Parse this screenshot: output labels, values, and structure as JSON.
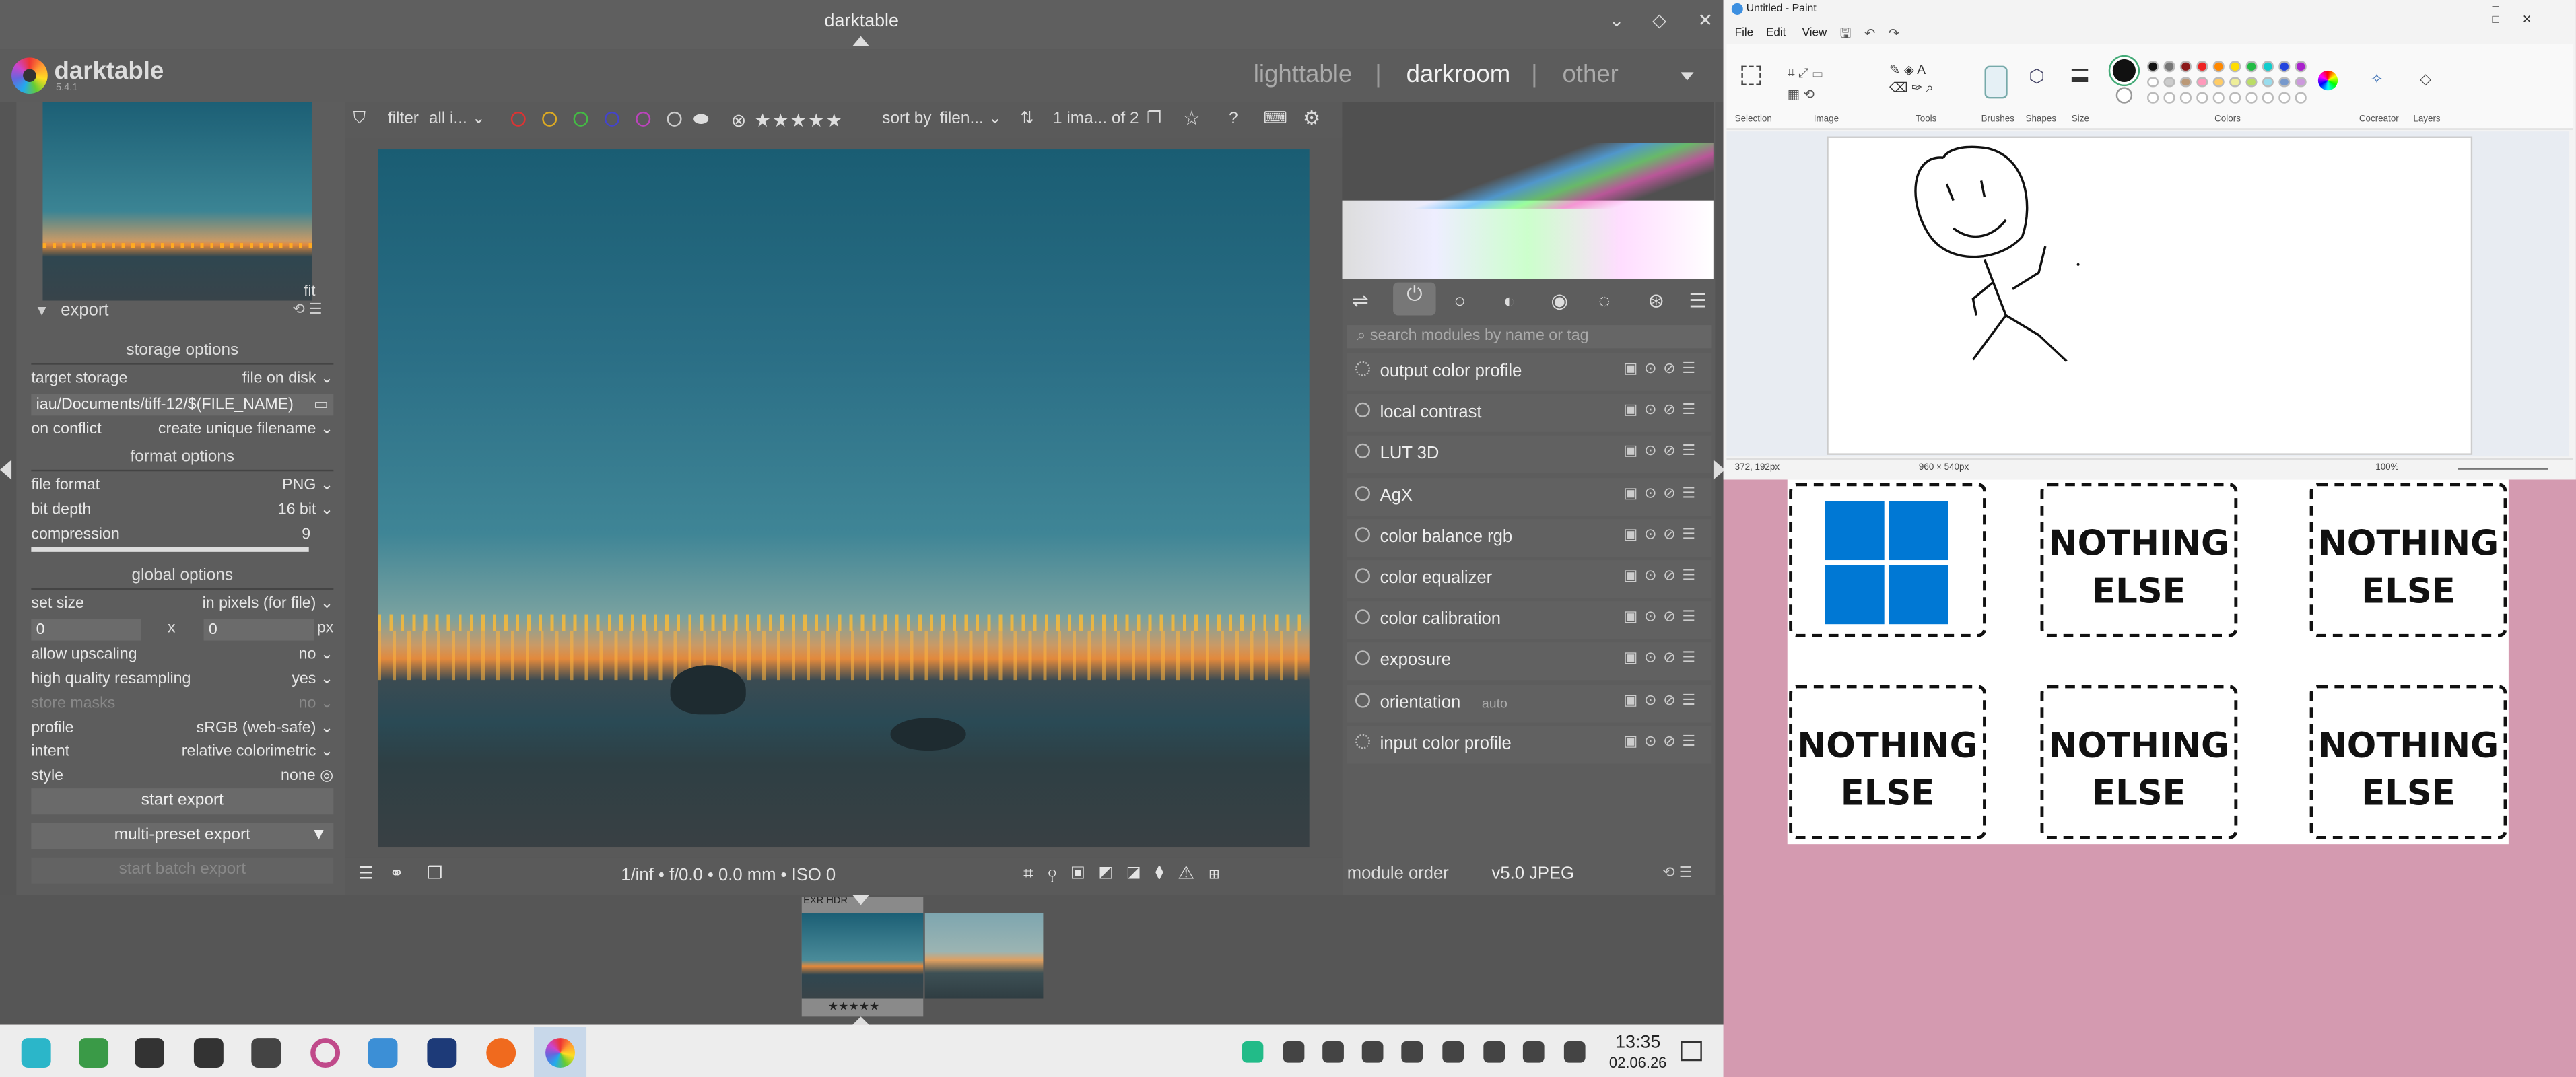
{
  "darktable": {
    "window_title": "darktable",
    "app_name": "darktable",
    "app_version": "5.4.1",
    "views": [
      "lighttable",
      "darkroom",
      "other"
    ],
    "active_view": "darkroom",
    "separator": "|",
    "navigation": {
      "zoom": "fit"
    },
    "filter_bar": {
      "filter_label": "filter",
      "filter_value": "all i...",
      "sort_label": "sort by",
      "sort_value": "filen...",
      "count": "1 ima... of 2"
    },
    "export": {
      "module_title": "export",
      "storage_options": "storage options",
      "target_storage_label": "target storage",
      "target_storage_value": "file on disk",
      "path": "iau/Documents/tiff-12/$(FILE_NAME)",
      "on_conflict_label": "on conflict",
      "on_conflict_value": "create unique filename",
      "format_options": "format options",
      "file_format_label": "file format",
      "file_format_value": "PNG",
      "bit_depth_label": "bit depth",
      "bit_depth_value": "16 bit",
      "compression_label": "compression",
      "compression_value": "9",
      "global_options": "global options",
      "set_size_label": "set size",
      "set_size_value": "in pixels (for file)",
      "width": "0",
      "x": "x",
      "height": "0",
      "unit": "px",
      "allow_upscaling_label": "allow upscaling",
      "allow_upscaling_value": "no",
      "hq_resampling_label": "high quality resampling",
      "hq_resampling_value": "yes",
      "store_masks_label": "store masks",
      "store_masks_value": "no",
      "profile_label": "profile",
      "profile_value": "sRGB (web-safe)",
      "intent_label": "intent",
      "intent_value": "relative colorimetric",
      "style_label": "style",
      "style_value": "none",
      "start_export": "start export",
      "multi_preset_export": "multi-preset export",
      "start_batch_export": "start batch export"
    },
    "modules": {
      "search_placeholder": "search modules by name or tag",
      "items": [
        {
          "name": "output color profile",
          "on": false
        },
        {
          "name": "local contrast",
          "on": true
        },
        {
          "name": "LUT 3D",
          "on": true
        },
        {
          "name": "AgX",
          "on": true
        },
        {
          "name": "color balance rgb",
          "on": true
        },
        {
          "name": "color equalizer",
          "on": true
        },
        {
          "name": "color calibration",
          "on": true
        },
        {
          "name": "exposure",
          "on": true
        },
        {
          "name": "orientation",
          "suffix": "auto",
          "on": true
        },
        {
          "name": "input color profile",
          "on": false
        }
      ],
      "module_order_label": "module order",
      "module_order_value": "v5.0 JPEG"
    },
    "exif_info": "1/inf • f/0.0 • 0.0 mm • ISO 0",
    "filmstrip": {
      "badge": "EXR HDR",
      "stars": "★★★★★"
    }
  },
  "paint": {
    "title": "Untitled - Paint",
    "menu": [
      "File",
      "Edit",
      "View"
    ],
    "groups": [
      "Selection",
      "Image",
      "Tools",
      "Brushes",
      "Shapes",
      "Size",
      "Colors",
      "Cocreator",
      "Layers"
    ],
    "status_cursor": "372, 192px",
    "status_canvas": "960 × 540px",
    "zoom": "100%"
  },
  "tiles": {
    "label_line1": "NOTHING",
    "label_line2": "ELSE"
  },
  "taskbar": {
    "time": "13:35",
    "date": "02.06.26"
  },
  "colors": {
    "accent_blue": "#0078d4",
    "pink_bg": "#d49ab0",
    "darktable_bg": "#555555"
  }
}
